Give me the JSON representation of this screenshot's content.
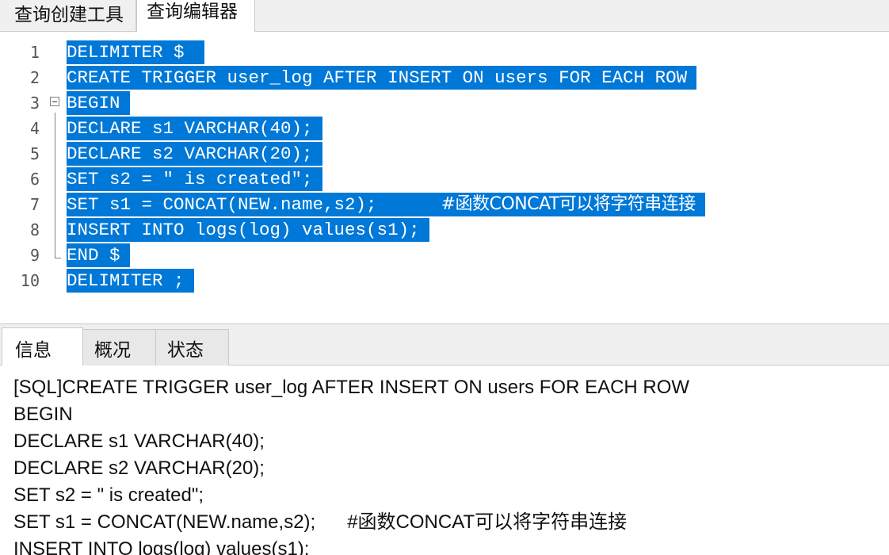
{
  "top_tabs": [
    {
      "label": "查询创建工具"
    },
    {
      "label": "查询编辑器"
    }
  ],
  "editor": {
    "lines": [
      {
        "number": "1",
        "code": "DELIMITER $ "
      },
      {
        "number": "2",
        "code": "CREATE TRIGGER user_log AFTER INSERT ON users FOR EACH ROW"
      },
      {
        "number": "3",
        "code": "BEGIN"
      },
      {
        "number": "4",
        "code": "DECLARE s1 VARCHAR(40);"
      },
      {
        "number": "5",
        "code": "DECLARE s2 VARCHAR(20);"
      },
      {
        "number": "6",
        "code": "SET s2 = \" is created\";"
      },
      {
        "number": "7",
        "code": "SET s1 = CONCAT(NEW.name,s2);      ",
        "comment": "#函数CONCAT可以将字符串连接"
      },
      {
        "number": "8",
        "code": "INSERT INTO logs(log) values(s1);"
      },
      {
        "number": "9",
        "code": "END $"
      },
      {
        "number": "10",
        "code": "DELIMITER ;"
      }
    ]
  },
  "bottom_tabs": [
    {
      "label": "信息"
    },
    {
      "label": "概况"
    },
    {
      "label": "状态"
    }
  ],
  "messages": [
    "[SQL]CREATE TRIGGER user_log AFTER INSERT ON users FOR EACH ROW",
    "BEGIN",
    "DECLARE s1 VARCHAR(40);",
    "DECLARE s2 VARCHAR(20);",
    "SET s2 = \" is created\";",
    "SET s1 = CONCAT(NEW.name,s2);      #函数CONCAT可以将字符串连接",
    "INSERT INTO logs(log) values(s1);"
  ],
  "colors": {
    "selection": "#0078d7",
    "tab_bar": "#f0f0f0"
  }
}
